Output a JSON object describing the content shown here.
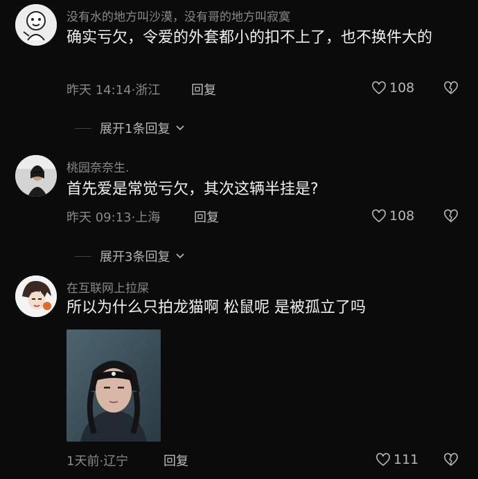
{
  "comments": [
    {
      "username": "没有水的地方叫沙漠，没有哥的地方叫寂寞",
      "text": "确实亏欠，令爱的外套都小的扣不上了，也不换件大的",
      "time": "昨天 14:14",
      "location": "浙江",
      "reply_label": "回复",
      "likes": "108",
      "expand_label": "展开1条回复"
    },
    {
      "username": "桃园奈奈生.",
      "text": "首先爱是常觉亏欠，其次这辆半挂是?",
      "time": "昨天 09:13",
      "location": "上海",
      "reply_label": "回复",
      "likes": "108",
      "expand_label": "展开3条回复"
    },
    {
      "username": "在互联网上拉屎",
      "text": "所以为什么只拍龙猫啊 松鼠呢 是被孤立了吗",
      "time": "1天前",
      "location": "辽宁",
      "reply_label": "回复",
      "likes": "111"
    }
  ],
  "colors": {
    "background": "#0b0b0b",
    "meta": "#8a8a8a",
    "text": "#f0f0f0"
  },
  "icons": [
    "heart-outline-icon",
    "broken-heart-icon",
    "chevron-down-icon"
  ]
}
